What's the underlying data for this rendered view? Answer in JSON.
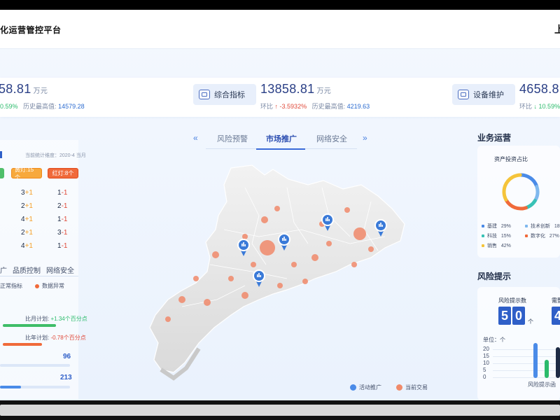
{
  "app": {
    "title": "化运营管控平台",
    "title_right": "上"
  },
  "stats": [
    {
      "badge": "",
      "value": "58.81",
      "unit": "万元",
      "ratio_label": "",
      "ratio": "0.59%",
      "dir": "up",
      "hist_label": "历史最高值:",
      "hist": "14579.28"
    },
    {
      "badge": "综合指标",
      "value": "13858.81",
      "unit": "万元",
      "ratio_label": "环比",
      "ratio": "-3.5932%",
      "dir": "up",
      "hist_label": "历史最高值:",
      "hist": "4219.63"
    },
    {
      "badge": "设备维护",
      "value": "4658.81",
      "unit": "",
      "ratio_label": "环比",
      "ratio": "10.59%",
      "dir": "down",
      "hist_label": "",
      "hist": ""
    }
  ],
  "left": {
    "header": "当前统计维度：2020-4  当月",
    "pills": [
      {
        "label": "黄灯:15个",
        "color": "#f59c2a"
      },
      {
        "label": "红灯:8个",
        "color": "#f0582e"
      }
    ],
    "rows": [
      [
        "3",
        "+1",
        "1",
        "-1"
      ],
      [
        "2",
        "+1",
        "2",
        "-1"
      ],
      [
        "4",
        "+1",
        "1",
        "-1"
      ],
      [
        "2",
        "+1",
        "3",
        "-1"
      ],
      [
        "4",
        "+1",
        "1",
        "-1"
      ]
    ],
    "tabs": [
      "广",
      "品质控制",
      "网络安全"
    ],
    "legend": [
      "正常指标",
      "数据异常"
    ],
    "plan1_label": "比月计划:",
    "plan1": "+1.34个百分点",
    "plan2_label": "比年计划:",
    "plan2": "-0.78个百分点",
    "val1": "96",
    "val2": "213"
  },
  "center": {
    "tabs": [
      "风险预警",
      "市场推广",
      "网络安全"
    ],
    "active": 1,
    "legend": [
      "活动推广",
      "当前交易"
    ]
  },
  "right": {
    "section1": "业务运营",
    "donut_title": "资产投资占比",
    "donut": [
      {
        "name": "基建",
        "pct": "29%",
        "color": "#4a8be8"
      },
      {
        "name": "技术创新",
        "pct": "18%",
        "color": "#7fb8ee"
      },
      {
        "name": "科技",
        "pct": "15%",
        "color": "#39c2b6"
      },
      {
        "name": "数字化",
        "pct": "27%",
        "color": "#f06a3a"
      },
      {
        "name": "销售",
        "pct": "42%",
        "color": "#f5c43a"
      }
    ],
    "section2": "风险提示",
    "risk_label": "风险提示数",
    "risk_label2": "需整",
    "digits": [
      "5",
      "0"
    ],
    "digits_unit": "个",
    "digit2": "4",
    "unit_label": "单位：个",
    "yticks": [
      "20",
      "15",
      "10",
      "5",
      "0"
    ],
    "bar_label": "风险提示函"
  }
}
